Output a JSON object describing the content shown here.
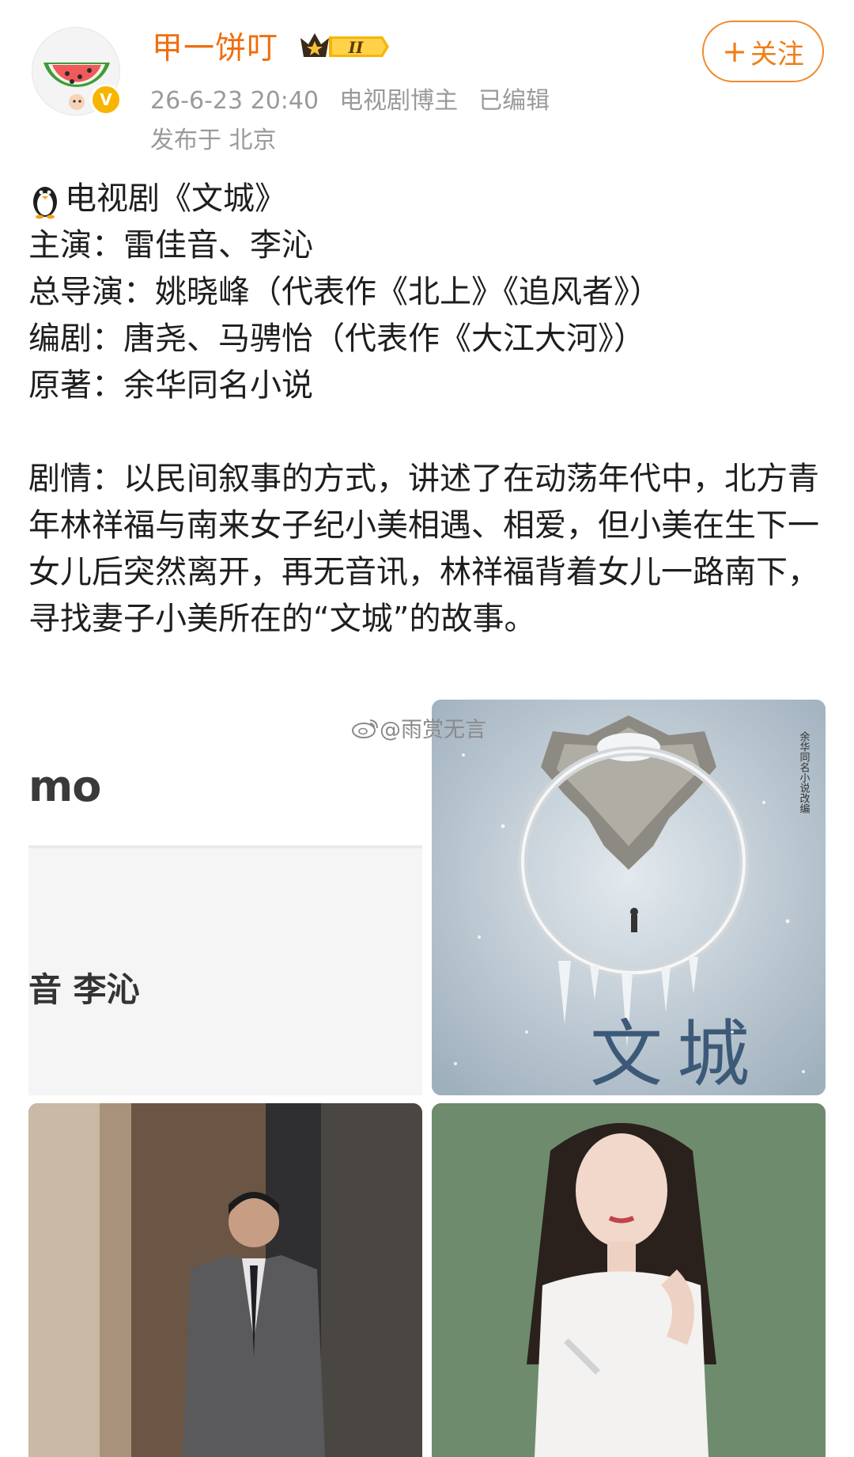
{
  "author": {
    "name": "甲一饼叮",
    "rank_label": "II",
    "avatar_icon": "watermelon-avatar-icon",
    "verified_icon": "verified-v-icon",
    "verified_glyph": "V"
  },
  "meta": {
    "timestamp": "26-6-23 20:40",
    "role": "电视剧博主",
    "edited": "已编辑",
    "location": "发布于 北京"
  },
  "follow_button": {
    "plus": "+",
    "label": "关注"
  },
  "post": {
    "title": "电视剧《文城》",
    "cast": "主演：雷佳音、李沁",
    "director": "总导演：姚晓峰（代表作《北上》《追风者》）",
    "writer": "编剧：唐尧、马骋怡（代表作《大江大河》）",
    "original": "原著：余华同名小说",
    "plot": "剧情：以民间叙事的方式，讲述了在动荡年代中，北方青年林祥福与南来女子纪小美相遇、相爱，但小美在生下一女儿后突然离开，再无音讯，林祥福背着女儿一路南下，寻找妻子小美所在的“文城”的故事。"
  },
  "watermark": "@雨赏无言",
  "images": {
    "crop_text_top": "mo",
    "crop_text_names": "音 李沁",
    "poster_title": "文城",
    "poster_side_text": "余华同名小说改编"
  },
  "colors": {
    "accent_orange": "#f06d0d",
    "meta_gray": "#9a9a9a",
    "verified_gold": "#f7b500"
  }
}
